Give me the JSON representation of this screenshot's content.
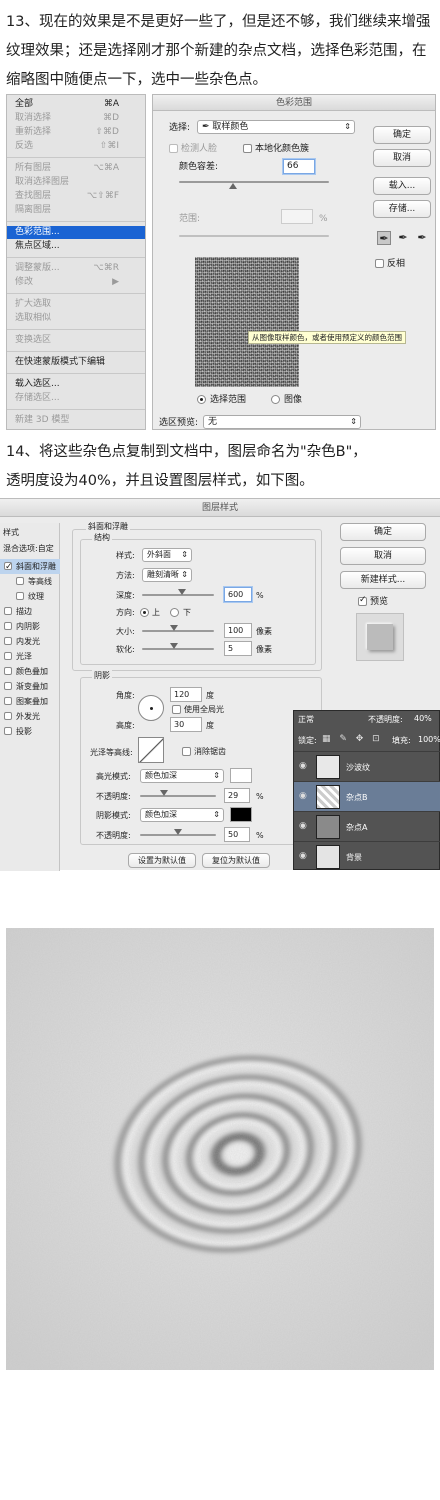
{
  "step13": {
    "text": "13、现在的效果是不是更好一些了，但是还不够，我们继续来增强纹理效果；还是选择刚才那个新建的杂点文档，选择色彩范围，在缩略图中随便点一下，选中一些杂色点。"
  },
  "select_menu": {
    "items": [
      {
        "label": "全部",
        "shortcut": "⌘A",
        "disabled": false
      },
      {
        "label": "取消选择",
        "shortcut": "⌘D",
        "disabled": true
      },
      {
        "label": "重新选择",
        "shortcut": "⇧⌘D",
        "disabled": true
      },
      {
        "label": "反选",
        "shortcut": "⇧⌘I",
        "disabled": true
      },
      {
        "label": "所有图层",
        "shortcut": "⌥⌘A",
        "disabled": true
      },
      {
        "label": "取消选择图层",
        "shortcut": "",
        "disabled": true
      },
      {
        "label": "查找图层",
        "shortcut": "⌥⇧⌘F",
        "disabled": true
      },
      {
        "label": "隔离图层",
        "shortcut": "",
        "disabled": true
      },
      {
        "label": "色彩范围...",
        "shortcut": "",
        "disabled": false,
        "selected": true
      },
      {
        "label": "焦点区域...",
        "shortcut": "",
        "disabled": false
      },
      {
        "label": "调整蒙版...",
        "shortcut": "⌥⌘R",
        "disabled": true
      },
      {
        "label": "修改",
        "shortcut": "▶",
        "disabled": true
      },
      {
        "label": "扩大选取",
        "shortcut": "",
        "disabled": true
      },
      {
        "label": "选取相似",
        "shortcut": "",
        "disabled": true
      },
      {
        "label": "变换选区",
        "shortcut": "",
        "disabled": true
      },
      {
        "label": "在快速蒙版模式下编辑",
        "shortcut": "",
        "disabled": false
      },
      {
        "label": "载入选区...",
        "shortcut": "",
        "disabled": false
      },
      {
        "label": "存储选区...",
        "shortcut": "",
        "disabled": true
      },
      {
        "label": "新建 3D 模型",
        "shortcut": "",
        "disabled": true
      }
    ]
  },
  "color_range": {
    "title": "色彩范围",
    "select_label": "选择:",
    "select_value": "取样颜色",
    "detect_faces": "检测人脸",
    "localized": "本地化颜色簇",
    "fuzziness_label": "颜色容差:",
    "fuzziness_value": "66",
    "range_label": "范围:",
    "range_unit": "%",
    "tooltip": "从图像取样颜色，或者使用预定义的颜色范围",
    "radio_selection": "选择范围",
    "radio_image": "图像",
    "preview_label": "选区预览:",
    "preview_value": "无",
    "btn_ok": "确定",
    "btn_cancel": "取消",
    "btn_load": "载入...",
    "btn_save": "存储...",
    "invert": "反相"
  },
  "step14": {
    "line1": "14、将这些杂色点复制到文档中，图层命名为\"杂色B\"，",
    "line2": "透明度设为40%，并且设置图层样式，如下图。"
  },
  "layer_style": {
    "title": "图层样式",
    "styles_header": "样式",
    "blend_options": "混合选项:自定",
    "items": [
      {
        "label": "斜面和浮雕",
        "checked": true,
        "highlight": true
      },
      {
        "label": "等高线",
        "checked": false,
        "sub": true
      },
      {
        "label": "纹理",
        "checked": false,
        "sub": true
      },
      {
        "label": "描边",
        "checked": false
      },
      {
        "label": "内阴影",
        "checked": false
      },
      {
        "label": "内发光",
        "checked": false
      },
      {
        "label": "光泽",
        "checked": false
      },
      {
        "label": "颜色叠加",
        "checked": false
      },
      {
        "label": "渐变叠加",
        "checked": false
      },
      {
        "label": "图案叠加",
        "checked": false
      },
      {
        "label": "外发光",
        "checked": false
      },
      {
        "label": "投影",
        "checked": false
      }
    ],
    "section_title": "斜面和浮雕",
    "structure": "结构",
    "style_label": "样式:",
    "style_value": "外斜面",
    "method_label": "方法:",
    "method_value": "雕刻清晰",
    "depth_label": "深度:",
    "depth_value": "600",
    "depth_unit": "%",
    "direction_label": "方向:",
    "dir_up": "上",
    "dir_down": "下",
    "size_label": "大小:",
    "size_value": "100",
    "size_unit": "像素",
    "soften_label": "软化:",
    "soften_value": "5",
    "soften_unit": "像素",
    "shading": "阴影",
    "angle_label": "角度:",
    "angle_value": "120",
    "angle_unit": "度",
    "global_light": "使用全局光",
    "altitude_label": "高度:",
    "altitude_value": "30",
    "altitude_unit": "度",
    "gloss_label": "光泽等高线:",
    "anti_alias": "消除锯齿",
    "highlight_label": "高光模式:",
    "highlight_value": "颜色加深",
    "hl_opacity_label": "不透明度:",
    "hl_opacity_value": "29",
    "shadow_label": "阴影模式:",
    "shadow_value": "颜色加深",
    "sh_opacity_label": "不透明度:",
    "sh_opacity_value": "50",
    "pct": "%",
    "btn_default": "设置为默认值",
    "btn_reset": "复位为默认值",
    "btn_ok": "确定",
    "btn_cancel": "取消",
    "btn_new": "新建样式...",
    "preview": "预览"
  },
  "layers_panel": {
    "blend": "正常",
    "opacity_label": "不透明度:",
    "opacity_value": "40%",
    "lock_label": "锁定:",
    "fill_label": "填充:",
    "fill_value": "100%",
    "layers": [
      {
        "name": "沙波纹",
        "selected": false
      },
      {
        "name": "杂点B",
        "selected": true
      },
      {
        "name": "杂点A",
        "selected": false
      },
      {
        "name": "背景",
        "selected": false
      }
    ]
  },
  "colors": {
    "selection_blue": "#1a63d3",
    "panel_dark": "#535353",
    "layer_selected": "#6a7d97"
  }
}
